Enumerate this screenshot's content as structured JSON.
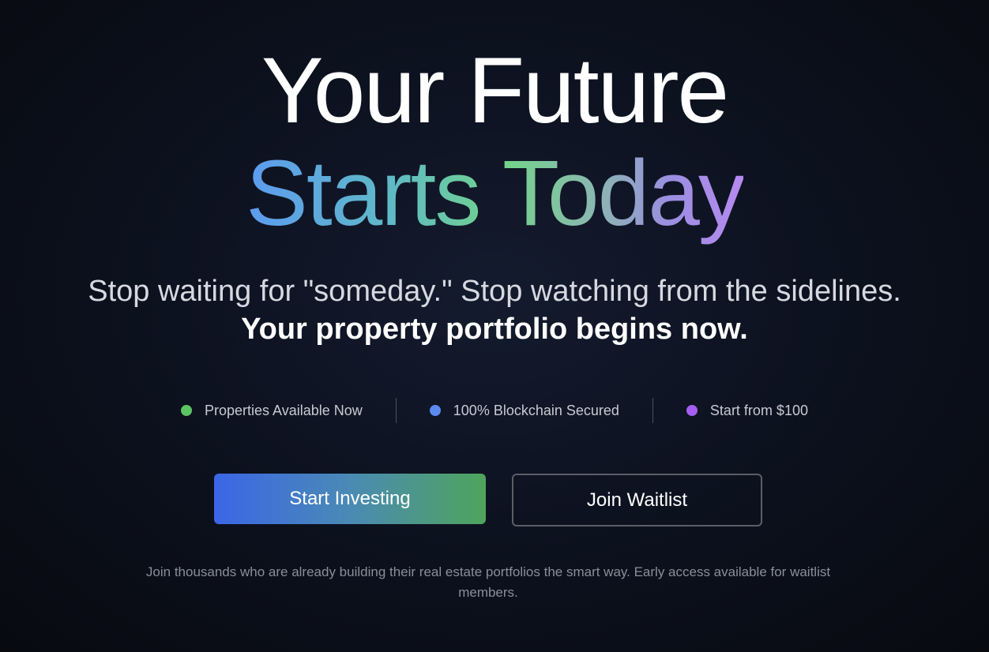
{
  "hero": {
    "headline_line1": "Your Future",
    "headline_line2": "Starts Today",
    "subtitle": "Stop waiting for \"someday.\" Stop watching from the sidelines.",
    "subtitle_strong": "Your property portfolio begins now.",
    "footnote": "Join thousands who are already building their real estate portfolios the smart way. Early access available for waitlist members."
  },
  "features": [
    {
      "label": "Properties Available Now",
      "color": "#5cc463"
    },
    {
      "label": "100% Blockchain Secured",
      "color": "#5b8af0"
    },
    {
      "label": "Start from $100",
      "color": "#a55ef0"
    }
  ],
  "buttons": {
    "primary_label": "Start Investing",
    "secondary_label": "Join Waitlist"
  }
}
